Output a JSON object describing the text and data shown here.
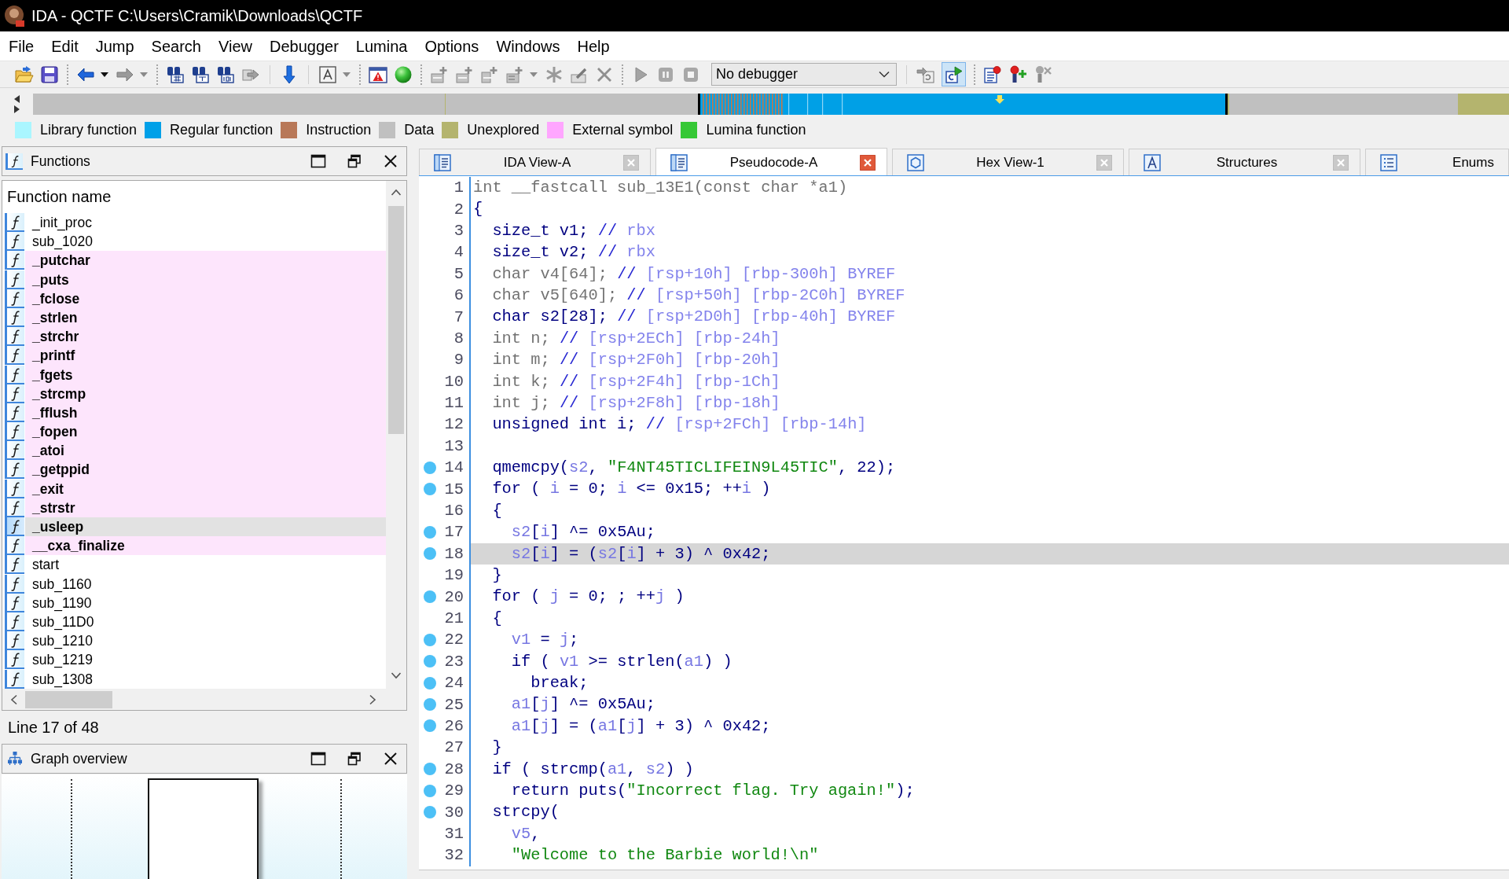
{
  "window": {
    "title": "IDA - QCTF C:\\Users\\Cramik\\Downloads\\QCTF"
  },
  "menu": [
    "File",
    "Edit",
    "Jump",
    "Search",
    "View",
    "Debugger",
    "Lumina",
    "Options",
    "Windows",
    "Help"
  ],
  "toolbar": {
    "debugger_select": {
      "value": "No debugger"
    },
    "toggle_button": {
      "on": true
    }
  },
  "legend": [
    {
      "label": "Library function",
      "color": "#aaf6ff"
    },
    {
      "label": "Regular function",
      "color": "#00a0e8"
    },
    {
      "label": "Instruction",
      "color": "#b87858"
    },
    {
      "label": "Data",
      "color": "#c0c0c0"
    },
    {
      "label": "Unexplored",
      "color": "#b4b46e"
    },
    {
      "label": "External symbol",
      "color": "#ffa6ff"
    },
    {
      "label": "Lumina function",
      "color": "#35c835"
    }
  ],
  "functions_panel": {
    "title": "Functions",
    "column": "Function name",
    "items": [
      {
        "name": "_init_proc",
        "kind": "regular",
        "selected": false
      },
      {
        "name": "sub_1020",
        "kind": "regular",
        "selected": false
      },
      {
        "name": "_putchar",
        "kind": "external",
        "selected": false
      },
      {
        "name": "_puts",
        "kind": "external",
        "selected": false
      },
      {
        "name": "_fclose",
        "kind": "external",
        "selected": false
      },
      {
        "name": "_strlen",
        "kind": "external",
        "selected": false
      },
      {
        "name": "_strchr",
        "kind": "external",
        "selected": false
      },
      {
        "name": "_printf",
        "kind": "external",
        "selected": false
      },
      {
        "name": "_fgets",
        "kind": "external",
        "selected": false
      },
      {
        "name": "_strcmp",
        "kind": "external",
        "selected": false
      },
      {
        "name": "_fflush",
        "kind": "external",
        "selected": false
      },
      {
        "name": "_fopen",
        "kind": "external",
        "selected": false
      },
      {
        "name": "_atoi",
        "kind": "external",
        "selected": false
      },
      {
        "name": "_getppid",
        "kind": "external",
        "selected": false
      },
      {
        "name": "_exit",
        "kind": "external",
        "selected": false
      },
      {
        "name": "_strstr",
        "kind": "external",
        "selected": false
      },
      {
        "name": "_usleep",
        "kind": "external",
        "selected": true
      },
      {
        "name": "__cxa_finalize",
        "kind": "external",
        "selected": false
      },
      {
        "name": "start",
        "kind": "regular",
        "selected": false
      },
      {
        "name": "sub_1160",
        "kind": "regular",
        "selected": false
      },
      {
        "name": "sub_1190",
        "kind": "regular",
        "selected": false
      },
      {
        "name": "sub_11D0",
        "kind": "regular",
        "selected": false
      },
      {
        "name": "sub_1210",
        "kind": "regular",
        "selected": false
      },
      {
        "name": "sub_1219",
        "kind": "regular",
        "selected": false
      },
      {
        "name": "sub_1308",
        "kind": "regular",
        "selected": false
      }
    ],
    "status": "Line 17 of 48"
  },
  "graph_overview": {
    "title": "Graph overview"
  },
  "tabs": [
    {
      "label": "IDA View-A",
      "kind": "disassembly",
      "selected": false,
      "closable": true
    },
    {
      "label": "Pseudocode-A",
      "kind": "pseudocode",
      "selected": true,
      "closable": true
    },
    {
      "label": "Hex View-1",
      "kind": "hex",
      "selected": false,
      "closable": true
    },
    {
      "label": "Structures",
      "kind": "structures",
      "selected": false,
      "closable": true
    },
    {
      "label": "Enums",
      "kind": "enums",
      "selected": false,
      "closable": false
    }
  ],
  "code": {
    "lines": [
      {
        "number": "1",
        "marked": false,
        "selected": false,
        "tokens": [
          {
            "text": "int __fastcall sub_13E1(const char *a1)",
            "kind": "muted"
          }
        ]
      },
      {
        "number": "2",
        "marked": false,
        "selected": false,
        "tokens": [
          {
            "text": "{",
            "kind": "plain"
          }
        ]
      },
      {
        "number": "3",
        "marked": false,
        "selected": false,
        "tokens": [
          {
            "text": "  size_t v1; ",
            "kind": "plain"
          },
          {
            "text": "//",
            "kind": "comment"
          },
          {
            "text": " rbx",
            "kind": "annotation"
          }
        ]
      },
      {
        "number": "4",
        "marked": false,
        "selected": false,
        "tokens": [
          {
            "text": "  size_t v2; ",
            "kind": "plain"
          },
          {
            "text": "//",
            "kind": "comment"
          },
          {
            "text": " rbx",
            "kind": "annotation"
          }
        ]
      },
      {
        "number": "5",
        "marked": false,
        "selected": false,
        "tokens": [
          {
            "text": "  char v4[64]; ",
            "kind": "muted"
          },
          {
            "text": "//",
            "kind": "comment"
          },
          {
            "text": " [rsp+10h] [rbp-300h] BYREF",
            "kind": "annotation"
          }
        ]
      },
      {
        "number": "6",
        "marked": false,
        "selected": false,
        "tokens": [
          {
            "text": "  char v5[640]; ",
            "kind": "muted"
          },
          {
            "text": "//",
            "kind": "comment"
          },
          {
            "text": " [rsp+50h] [rbp-2C0h] BYREF",
            "kind": "annotation"
          }
        ]
      },
      {
        "number": "7",
        "marked": false,
        "selected": false,
        "tokens": [
          {
            "text": "  char s2[28]; ",
            "kind": "plain"
          },
          {
            "text": "//",
            "kind": "comment"
          },
          {
            "text": " [rsp+2D0h] [rbp-40h] BYREF",
            "kind": "annotation"
          }
        ]
      },
      {
        "number": "8",
        "marked": false,
        "selected": false,
        "tokens": [
          {
            "text": "  int n; ",
            "kind": "muted"
          },
          {
            "text": "//",
            "kind": "comment"
          },
          {
            "text": " [rsp+2ECh] [rbp-24h]",
            "kind": "annotation"
          }
        ]
      },
      {
        "number": "9",
        "marked": false,
        "selected": false,
        "tokens": [
          {
            "text": "  int m; ",
            "kind": "muted"
          },
          {
            "text": "//",
            "kind": "comment"
          },
          {
            "text": " [rsp+2F0h] [rbp-20h]",
            "kind": "annotation"
          }
        ]
      },
      {
        "number": "10",
        "marked": false,
        "selected": false,
        "tokens": [
          {
            "text": "  int k; ",
            "kind": "muted"
          },
          {
            "text": "//",
            "kind": "comment"
          },
          {
            "text": " [rsp+2F4h] [rbp-1Ch]",
            "kind": "annotation"
          }
        ]
      },
      {
        "number": "11",
        "marked": false,
        "selected": false,
        "tokens": [
          {
            "text": "  int j; ",
            "kind": "muted"
          },
          {
            "text": "//",
            "kind": "comment"
          },
          {
            "text": " [rsp+2F8h] [rbp-18h]",
            "kind": "annotation"
          }
        ]
      },
      {
        "number": "12",
        "marked": false,
        "selected": false,
        "tokens": [
          {
            "text": "  unsigned int i; ",
            "kind": "plain"
          },
          {
            "text": "//",
            "kind": "comment"
          },
          {
            "text": " [rsp+2FCh] [rbp-14h]",
            "kind": "annotation"
          }
        ]
      },
      {
        "number": "13",
        "marked": false,
        "selected": false
      },
      {
        "number": "14",
        "marked": true,
        "selected": false,
        "tokens": [
          {
            "text": "  qmemcpy(",
            "kind": "plain"
          },
          {
            "text": "s2",
            "kind": "var"
          },
          {
            "text": ", ",
            "kind": "plain"
          },
          {
            "text": "\"F4NT45TICLIFEIN9L45TIC\"",
            "kind": "string"
          },
          {
            "text": ", 22);",
            "kind": "plain"
          }
        ]
      },
      {
        "number": "15",
        "marked": true,
        "selected": false,
        "tokens": [
          {
            "text": "  for ( ",
            "kind": "plain"
          },
          {
            "text": "i",
            "kind": "var"
          },
          {
            "text": " = 0; ",
            "kind": "plain"
          },
          {
            "text": "i",
            "kind": "var"
          },
          {
            "text": " <= 0x15; ++",
            "kind": "plain"
          },
          {
            "text": "i",
            "kind": "var"
          },
          {
            "text": " )",
            "kind": "plain"
          }
        ]
      },
      {
        "number": "16",
        "marked": false,
        "selected": false,
        "tokens": [
          {
            "text": "  {",
            "kind": "plain"
          }
        ]
      },
      {
        "number": "17",
        "marked": true,
        "selected": false,
        "tokens": [
          {
            "text": "    s2",
            "kind": "var"
          },
          {
            "text": "[",
            "kind": "plain"
          },
          {
            "text": "i",
            "kind": "var"
          },
          {
            "text": "] ^= 0x5Au;",
            "kind": "plain"
          }
        ]
      },
      {
        "number": "18",
        "marked": true,
        "selected": true,
        "tokens": [
          {
            "text": "    s2",
            "kind": "var"
          },
          {
            "text": "[",
            "kind": "plain"
          },
          {
            "text": "i",
            "kind": "var"
          },
          {
            "text": "] = (",
            "kind": "plain"
          },
          {
            "text": "s2",
            "kind": "var"
          },
          {
            "text": "[",
            "kind": "plain"
          },
          {
            "text": "i",
            "kind": "var"
          },
          {
            "text": "] + 3) ^ 0x42;",
            "kind": "plain"
          }
        ]
      },
      {
        "number": "19",
        "marked": false,
        "selected": false,
        "tokens": [
          {
            "text": "  }",
            "kind": "plain"
          }
        ]
      },
      {
        "number": "20",
        "marked": true,
        "selected": false,
        "tokens": [
          {
            "text": "  for ( ",
            "kind": "plain"
          },
          {
            "text": "j",
            "kind": "var"
          },
          {
            "text": " = 0; ; ++",
            "kind": "plain"
          },
          {
            "text": "j",
            "kind": "var"
          },
          {
            "text": " )",
            "kind": "plain"
          }
        ]
      },
      {
        "number": "21",
        "marked": false,
        "selected": false,
        "tokens": [
          {
            "text": "  {",
            "kind": "plain"
          }
        ]
      },
      {
        "number": "22",
        "marked": true,
        "selected": false,
        "tokens": [
          {
            "text": "    v1",
            "kind": "var"
          },
          {
            "text": " = ",
            "kind": "plain"
          },
          {
            "text": "j",
            "kind": "var"
          },
          {
            "text": ";",
            "kind": "plain"
          }
        ]
      },
      {
        "number": "23",
        "marked": true,
        "selected": false,
        "tokens": [
          {
            "text": "    if ( ",
            "kind": "plain"
          },
          {
            "text": "v1",
            "kind": "var"
          },
          {
            "text": " >= strlen(",
            "kind": "plain"
          },
          {
            "text": "a1",
            "kind": "var"
          },
          {
            "text": ") )",
            "kind": "plain"
          }
        ]
      },
      {
        "number": "24",
        "marked": true,
        "selected": false,
        "tokens": [
          {
            "text": "      break;",
            "kind": "plain"
          }
        ]
      },
      {
        "number": "25",
        "marked": true,
        "selected": false,
        "tokens": [
          {
            "text": "    a1",
            "kind": "var"
          },
          {
            "text": "[",
            "kind": "plain"
          },
          {
            "text": "j",
            "kind": "var"
          },
          {
            "text": "] ^= 0x5Au;",
            "kind": "plain"
          }
        ]
      },
      {
        "number": "26",
        "marked": true,
        "selected": false,
        "tokens": [
          {
            "text": "    a1",
            "kind": "var"
          },
          {
            "text": "[",
            "kind": "plain"
          },
          {
            "text": "j",
            "kind": "var"
          },
          {
            "text": "] = (",
            "kind": "plain"
          },
          {
            "text": "a1",
            "kind": "var"
          },
          {
            "text": "[",
            "kind": "plain"
          },
          {
            "text": "j",
            "kind": "var"
          },
          {
            "text": "] + 3) ^ 0x42;",
            "kind": "plain"
          }
        ]
      },
      {
        "number": "27",
        "marked": false,
        "selected": false,
        "tokens": [
          {
            "text": "  }",
            "kind": "plain"
          }
        ]
      },
      {
        "number": "28",
        "marked": true,
        "selected": false,
        "tokens": [
          {
            "text": "  if ( strcmp(",
            "kind": "plain"
          },
          {
            "text": "a1",
            "kind": "var"
          },
          {
            "text": ", ",
            "kind": "plain"
          },
          {
            "text": "s2",
            "kind": "var"
          },
          {
            "text": ") )",
            "kind": "plain"
          }
        ]
      },
      {
        "number": "29",
        "marked": true,
        "selected": false,
        "tokens": [
          {
            "text": "    return puts(",
            "kind": "plain"
          },
          {
            "text": "\"Incorrect flag. Try again!\"",
            "kind": "string"
          },
          {
            "text": ");",
            "kind": "plain"
          }
        ]
      },
      {
        "number": "30",
        "marked": true,
        "selected": false,
        "tokens": [
          {
            "text": "  strcpy(",
            "kind": "plain"
          }
        ]
      },
      {
        "number": "31",
        "marked": false,
        "selected": false,
        "tokens": [
          {
            "text": "    v5",
            "kind": "var"
          },
          {
            "text": ",",
            "kind": "plain"
          }
        ]
      },
      {
        "number": "32",
        "marked": false,
        "selected": false,
        "tokens": [
          {
            "text": "    \"Welcome to the Barbie world!\\n\"",
            "kind": "string"
          }
        ]
      }
    ]
  }
}
